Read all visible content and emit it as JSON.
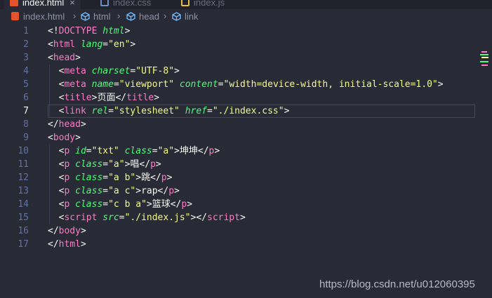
{
  "tabs": [
    {
      "label": "index.html",
      "active": true,
      "icon": "html5-icon"
    },
    {
      "label": "index.css",
      "active": false,
      "icon": "css-icon"
    },
    {
      "label": "index.js",
      "active": false,
      "icon": "js-icon"
    }
  ],
  "breadcrumb": {
    "file": "index.html",
    "items": [
      "html",
      "head",
      "link"
    ]
  },
  "lines": [
    {
      "n": "1",
      "tokens": [
        [
          "p",
          "<!"
        ],
        [
          "t",
          "DOCTYPE"
        ],
        [
          "p",
          " "
        ],
        [
          "a",
          "html"
        ],
        [
          "p",
          ">"
        ]
      ]
    },
    {
      "n": "2",
      "tokens": [
        [
          "p",
          "<"
        ],
        [
          "t",
          "html"
        ],
        [
          "p",
          " "
        ],
        [
          "a",
          "lang"
        ],
        [
          "p",
          "="
        ],
        [
          "s",
          "\"en\""
        ],
        [
          "p",
          ">"
        ]
      ]
    },
    {
      "n": "3",
      "tokens": [
        [
          "p",
          "<"
        ],
        [
          "t",
          "head"
        ],
        [
          "p",
          ">"
        ]
      ]
    },
    {
      "n": "4",
      "tokens": [
        [
          "p",
          "  <"
        ],
        [
          "t",
          "meta"
        ],
        [
          "p",
          " "
        ],
        [
          "a",
          "charset"
        ],
        [
          "p",
          "="
        ],
        [
          "s",
          "\"UTF-8\""
        ],
        [
          "p",
          ">"
        ]
      ]
    },
    {
      "n": "5",
      "tokens": [
        [
          "p",
          "  <"
        ],
        [
          "t",
          "meta"
        ],
        [
          "p",
          " "
        ],
        [
          "a",
          "name"
        ],
        [
          "p",
          "="
        ],
        [
          "s",
          "\"viewport\""
        ],
        [
          "p",
          " "
        ],
        [
          "a",
          "content"
        ],
        [
          "p",
          "="
        ],
        [
          "s",
          "\"width=device-width, initial-scale=1.0\""
        ],
        [
          "p",
          ">"
        ]
      ]
    },
    {
      "n": "6",
      "tokens": [
        [
          "p",
          "  <"
        ],
        [
          "t",
          "title"
        ],
        [
          "p",
          ">页面</"
        ],
        [
          "t",
          "title"
        ],
        [
          "p",
          ">"
        ]
      ]
    },
    {
      "n": "7",
      "tokens": [
        [
          "p",
          "  <"
        ],
        [
          "t",
          "link"
        ],
        [
          "p",
          " "
        ],
        [
          "a",
          "rel"
        ],
        [
          "p",
          "="
        ],
        [
          "s",
          "\"stylesheet\""
        ],
        [
          "p",
          " "
        ],
        [
          "a",
          "href"
        ],
        [
          "p",
          "="
        ],
        [
          "s",
          "\"./index.css\""
        ],
        [
          "p",
          ">"
        ]
      ]
    },
    {
      "n": "8",
      "tokens": [
        [
          "p",
          "</"
        ],
        [
          "t",
          "head"
        ],
        [
          "p",
          ">"
        ]
      ]
    },
    {
      "n": "9",
      "tokens": [
        [
          "p",
          "<"
        ],
        [
          "t",
          "body"
        ],
        [
          "p",
          ">"
        ]
      ]
    },
    {
      "n": "10",
      "tokens": [
        [
          "p",
          "  <"
        ],
        [
          "t",
          "p"
        ],
        [
          "p",
          " "
        ],
        [
          "a",
          "id"
        ],
        [
          "p",
          "="
        ],
        [
          "s",
          "\"txt\""
        ],
        [
          "p",
          " "
        ],
        [
          "a",
          "class"
        ],
        [
          "p",
          "="
        ],
        [
          "s",
          "\"a\""
        ],
        [
          "p",
          ">坤坤</"
        ],
        [
          "t",
          "p"
        ],
        [
          "p",
          ">"
        ]
      ]
    },
    {
      "n": "11",
      "tokens": [
        [
          "p",
          "  <"
        ],
        [
          "t",
          "p"
        ],
        [
          "p",
          " "
        ],
        [
          "a",
          "class"
        ],
        [
          "p",
          "="
        ],
        [
          "s",
          "\"a\""
        ],
        [
          "p",
          ">唱</"
        ],
        [
          "t",
          "p"
        ],
        [
          "p",
          ">"
        ]
      ]
    },
    {
      "n": "12",
      "tokens": [
        [
          "p",
          "  <"
        ],
        [
          "t",
          "p"
        ],
        [
          "p",
          " "
        ],
        [
          "a",
          "class"
        ],
        [
          "p",
          "="
        ],
        [
          "s",
          "\"a b\""
        ],
        [
          "p",
          ">跳</"
        ],
        [
          "t",
          "p"
        ],
        [
          "p",
          ">"
        ]
      ]
    },
    {
      "n": "13",
      "tokens": [
        [
          "p",
          "  <"
        ],
        [
          "t",
          "p"
        ],
        [
          "p",
          " "
        ],
        [
          "a",
          "class"
        ],
        [
          "p",
          "="
        ],
        [
          "s",
          "\"a c\""
        ],
        [
          "p",
          ">rap</"
        ],
        [
          "t",
          "p"
        ],
        [
          "p",
          ">"
        ]
      ]
    },
    {
      "n": "14",
      "tokens": [
        [
          "p",
          "  <"
        ],
        [
          "t",
          "p"
        ],
        [
          "p",
          " "
        ],
        [
          "a",
          "class"
        ],
        [
          "p",
          "="
        ],
        [
          "s",
          "\"c b a\""
        ],
        [
          "p",
          ">篮球</"
        ],
        [
          "t",
          "p"
        ],
        [
          "p",
          ">"
        ]
      ]
    },
    {
      "n": "15",
      "tokens": [
        [
          "p",
          "  <"
        ],
        [
          "t",
          "script"
        ],
        [
          "p",
          " "
        ],
        [
          "a",
          "src"
        ],
        [
          "p",
          "="
        ],
        [
          "s",
          "\"./index.js\""
        ],
        [
          "p",
          "></"
        ],
        [
          "t",
          "script"
        ],
        [
          "p",
          ">"
        ]
      ]
    },
    {
      "n": "16",
      "tokens": [
        [
          "p",
          "</"
        ],
        [
          "t",
          "body"
        ],
        [
          "p",
          ">"
        ]
      ]
    },
    {
      "n": "17",
      "tokens": [
        [
          "p",
          "</"
        ],
        [
          "t",
          "html"
        ],
        [
          "p",
          ">"
        ]
      ]
    }
  ],
  "current_line": "7",
  "watermark": "https://blog.csdn.net/u012060395",
  "colors": {
    "background": "#282a36",
    "tag": "#ff79c6",
    "attr": "#50fa7b",
    "string": "#f1fa8c",
    "linenum": "#6272a4"
  }
}
